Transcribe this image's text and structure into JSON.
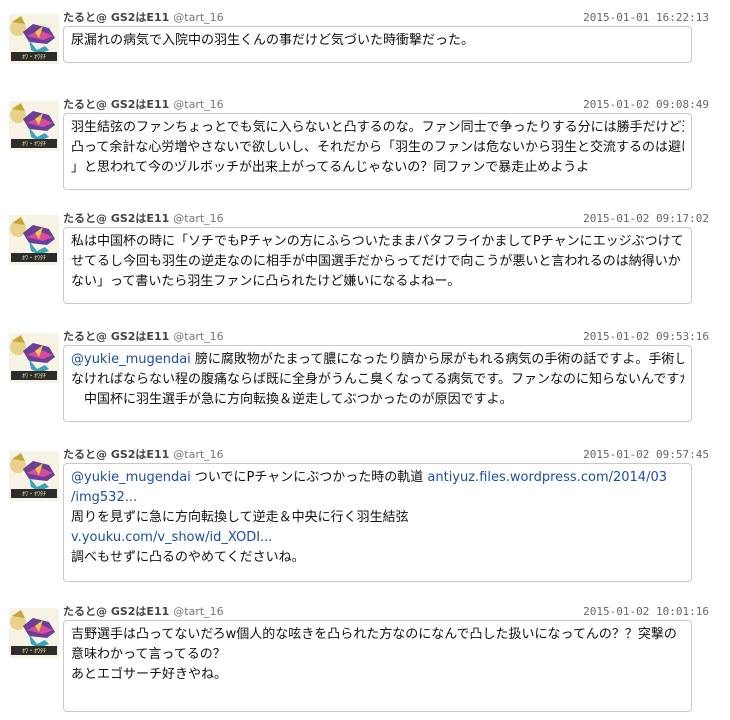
{
  "tweets": [
    {
      "name": "たると@ GS2はE11",
      "handle": "@tart_16",
      "timestamp": "2015-01-01 16:22:13",
      "lines": [
        {
          "mention": "",
          "text": "尿漏れの病気で入院中の羽生くんの事だけど気づいた時衝撃だった。"
        }
      ]
    },
    {
      "name": "たると@ GS2はE11",
      "handle": "@tart_16",
      "timestamp": "2015-01-02 09:08:49",
      "lines": [
        {
          "mention": "",
          "text": "羽生結弦のファンちょっとでも気に入らないと凸するのな。ファン同士で争ったりする分には勝手だけど選手に"
        },
        {
          "mention": "",
          "text": "凸って余計な心労増やさないで欲しいし、それだから「羽生のファンは危ないから羽生と交流するのは避けよう"
        },
        {
          "mention": "",
          "text": "」と思われて今のヅルボッチが出来上がってるんじゃないの？同ファンで暴走止めようよ"
        }
      ]
    },
    {
      "name": "たると@ GS2はE11",
      "handle": "@tart_16",
      "timestamp": "2015-01-02 09:17:02",
      "lines": [
        {
          "mention": "",
          "text": "私は中国杯の時に「ソチでもPチャンの方にふらついたままバタフライかましてPチャンにエッジぶつけて怪我さ"
        },
        {
          "mention": "",
          "text": "せてるし今回も羽生の逆走なのに相手が中国選手だからってだけで向こうが悪いと言われるのは納得いか"
        },
        {
          "mention": "",
          "text": "ない」って書いたら羽生ファンに凸られたけど嫌いになるよねー。"
        }
      ]
    },
    {
      "name": "たると@ GS2はE11",
      "handle": "@tart_16",
      "timestamp": "2015-01-02 09:53:16",
      "lines": [
        {
          "mention": "@yukie_mugendai",
          "text": " 膀に腐敗物がたまって膿になったり臍から尿がもれる病気の手術の話ですよ。手術し"
        },
        {
          "mention": "",
          "text": "なければならない程の腹痛ならば既に全身がうんこ臭くなってる病気です。ファンなのに知らないんですか？"
        },
        {
          "mention": "",
          "text": "　中国杯に羽生選手が急に方向転換＆逆走してぶつかったのが原因ですよ。"
        }
      ]
    },
    {
      "name": "たると@ GS2はE11",
      "handle": "@tart_16",
      "timestamp": "2015-01-02 09:57:45",
      "lines": [
        {
          "mention": "@yukie_mugendai",
          "text": " ついでにPチャンにぶつかった時の軌道 ",
          "link": "antiyuz.files.wordpress.com/2014/03"
        },
        {
          "mention": "",
          "text": "",
          "link": "/img532..."
        },
        {
          "mention": "",
          "text": "周りを見ずに急に方向転換して逆走＆中央に行く羽生結弦"
        },
        {
          "mention": "",
          "text": "",
          "link": "v.youku.com/v_show/id_XODI..."
        },
        {
          "mention": "",
          "text": "調べもせずに凸るのやめてくださいね。"
        }
      ]
    },
    {
      "name": "たると@ GS2はE11",
      "handle": "@tart_16",
      "timestamp": "2015-01-02 10:01:16",
      "lines": [
        {
          "mention": "",
          "text": "吉野選手は凸ってないだろw個人的な呟きを凸られた方なのになんで凸した扱いになってんの？？突撃の"
        },
        {
          "mention": "",
          "text": "意味わかって言ってるの？"
        },
        {
          "mention": "",
          "text": "あとエゴサーチ好きやね。"
        }
      ]
    }
  ],
  "colors": {
    "link": "#1d4e9e",
    "border": "#c9c9c9"
  },
  "icons": {
    "avatar": "user-avatar-icon"
  }
}
